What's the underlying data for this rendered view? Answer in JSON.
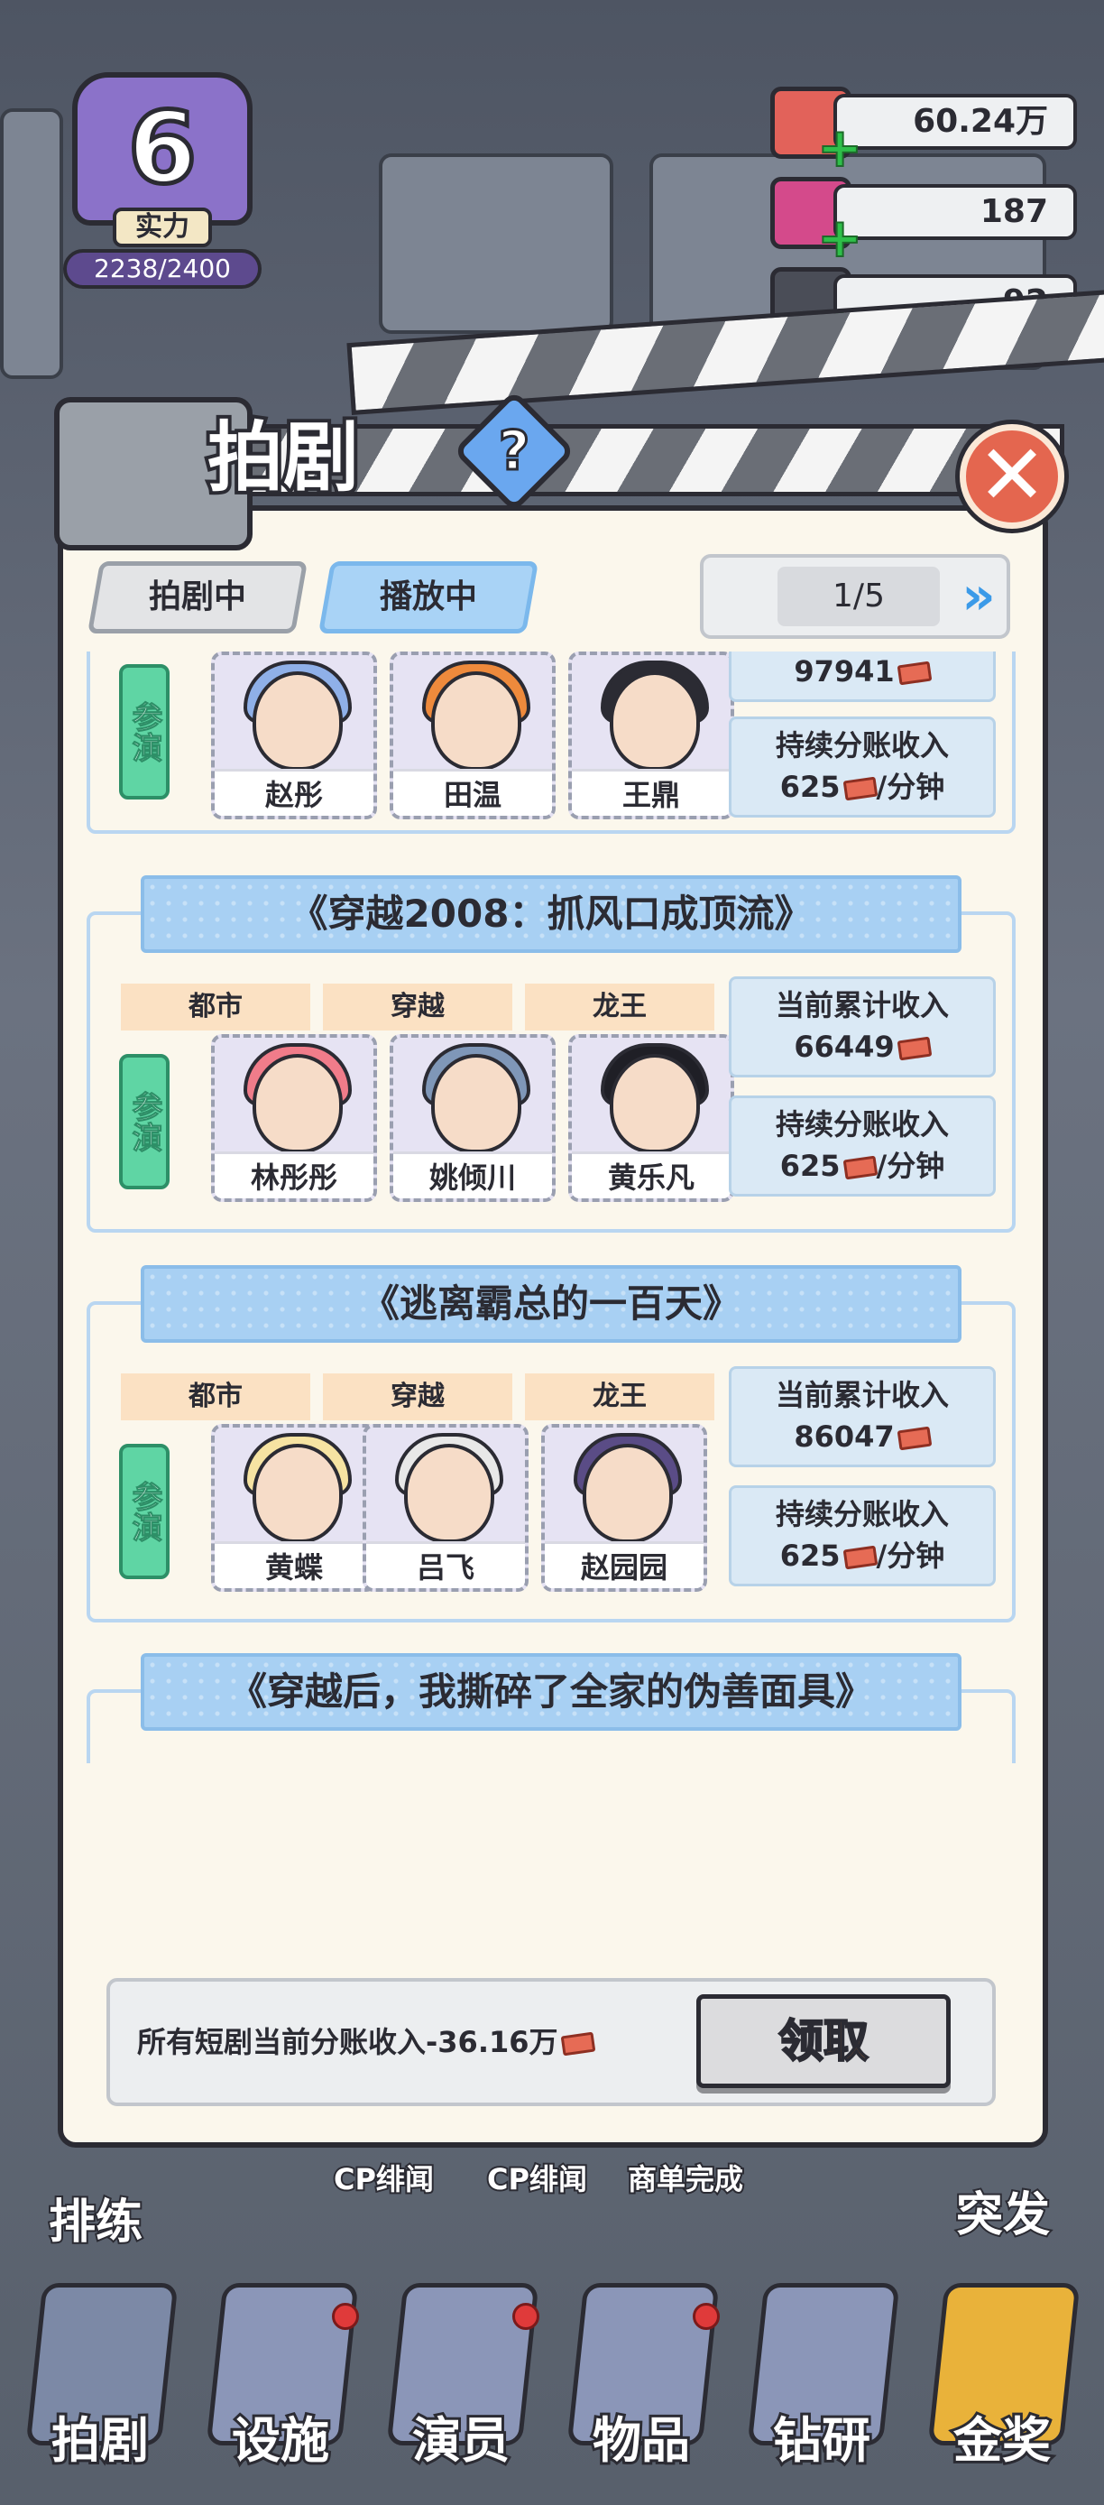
{
  "level": {
    "value": "6",
    "label": "实力",
    "score": "2238/2400"
  },
  "resources": [
    {
      "icon": "cash-stack-icon",
      "value": "60.24万"
    },
    {
      "icon": "pink-gem-icon",
      "value": "187"
    },
    {
      "icon": "film-ticket-icon",
      "value": "92"
    }
  ],
  "panel": {
    "title": "拍剧",
    "help": "?",
    "close": "✕",
    "tabs": [
      {
        "label": "拍剧中",
        "active": false
      },
      {
        "label": "播放中",
        "active": true
      }
    ],
    "pager": {
      "value": "1/5",
      "next": "»"
    }
  },
  "dramas": [
    {
      "title": "",
      "tags": [],
      "cast_label": "参演",
      "actors": [
        "赵彤",
        "田温",
        "王鼎"
      ],
      "stats": {
        "total_label": "",
        "total_value": "97941",
        "rate_label": "持续分账收入",
        "rate_value": "625",
        "rate_unit": "/分钟"
      }
    },
    {
      "title": "《穿越2008：抓风口成顶流》",
      "tags": [
        "都市",
        "穿越",
        "龙王"
      ],
      "cast_label": "参演",
      "actors": [
        "林彤彤",
        "姚倾川",
        "黄乐凡"
      ],
      "stats": {
        "total_label": "当前累计收入",
        "total_value": "66449",
        "rate_label": "持续分账收入",
        "rate_value": "625",
        "rate_unit": "/分钟"
      }
    },
    {
      "title": "《逃离霸总的一百天》",
      "tags": [
        "都市",
        "穿越",
        "龙王"
      ],
      "cast_label": "参演",
      "actors": [
        "黄蝶",
        "吕飞",
        "赵园园"
      ],
      "stats": {
        "total_label": "当前累计收入",
        "total_value": "86047",
        "rate_label": "持续分账收入",
        "rate_value": "625",
        "rate_unit": "/分钟"
      }
    },
    {
      "title": "《穿越后，我撕碎了全家的伪善面具》",
      "tags": [],
      "cast_label": "",
      "actors": [],
      "stats": {}
    }
  ],
  "footer": {
    "summary": "所有短剧当前分账收入-36.16万",
    "claim_label": "领取"
  },
  "quick_actions": [
    "排练",
    "CP绯闻",
    "CP绯闻",
    "商单完成",
    "突发"
  ],
  "nav": [
    "拍剧",
    "设施",
    "演员",
    "物品",
    "钻研",
    "金奖"
  ],
  "colors": {
    "accent_blue": "#a8d0f3",
    "cast_green": "#5fd5a4",
    "tag_orange": "#fbe1c3",
    "close_red": "#e4664f"
  }
}
